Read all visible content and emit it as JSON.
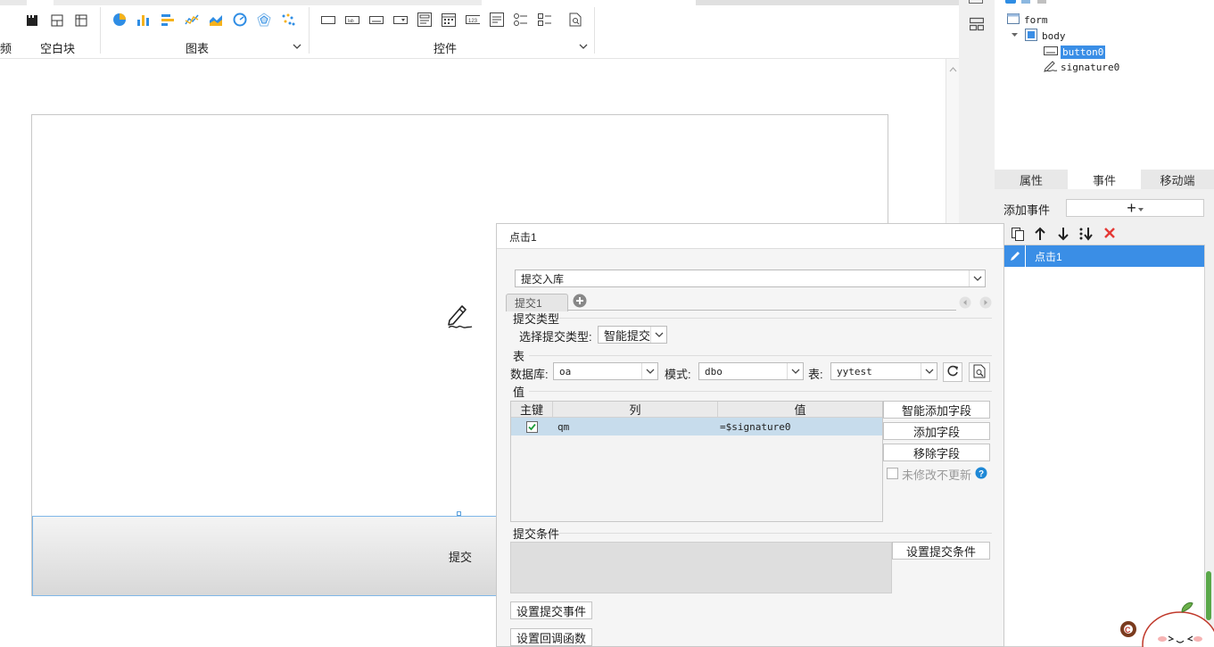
{
  "ribbon": {
    "groups": [
      {
        "label": "空白块"
      },
      {
        "label": "图表"
      },
      {
        "label": "控件"
      }
    ],
    "partial_left_label": "频"
  },
  "canvas": {
    "submit_button_label": "提交"
  },
  "tree": {
    "nodes": [
      {
        "label": "form",
        "icon": "form-icon"
      },
      {
        "label": "body",
        "icon": "body-icon"
      },
      {
        "label": "button0",
        "icon": "button-icon",
        "selected": true
      },
      {
        "label": "signature0",
        "icon": "signature-icon"
      }
    ]
  },
  "panel_tabs": [
    {
      "label": "属性"
    },
    {
      "label": "事件",
      "active": true
    },
    {
      "label": "移动端"
    }
  ],
  "events": {
    "add_label": "添加事件",
    "add_symbol": "+",
    "items": [
      {
        "label": "点击1",
        "selected": true
      }
    ]
  },
  "dialog": {
    "title": "点击1",
    "action_select": "提交入库",
    "sub_tab": "提交1",
    "submit_type_section": "提交类型",
    "choose_type_label": "选择提交类型:",
    "type_value": "智能提交",
    "table_section": "表",
    "db_label": "数据库:",
    "db_value": "oa",
    "schema_label": "模式:",
    "schema_value": "dbo",
    "table_label": "表:",
    "table_value": "yytest",
    "value_section": "值",
    "grid_headers": [
      "主键",
      "列",
      "值"
    ],
    "grid_rows": [
      {
        "key": true,
        "column": "qm",
        "value": "=$signature0"
      }
    ],
    "smart_add_button": "智能添加字段",
    "add_field_button": "添加字段",
    "remove_field_button": "移除字段",
    "no_update_label": "未修改不更新",
    "condition_section": "提交条件",
    "set_condition_button": "设置提交条件",
    "set_event_button": "设置提交事件",
    "set_callback_button": "设置回调函数"
  },
  "colors": {
    "accent": "#3a8ee6",
    "selected_row": "#c7dcec",
    "delete_red": "#e53935"
  }
}
